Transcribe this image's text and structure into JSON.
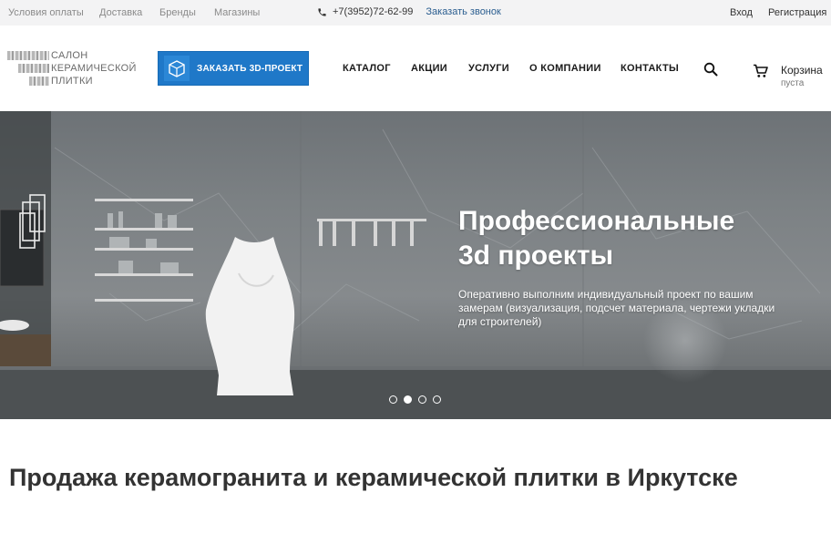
{
  "topbar": {
    "links": [
      "Условия оплаты",
      "Доставка",
      "Бренды",
      "Магазины"
    ],
    "phone": "+7(3952)72-62-99",
    "callback": "Заказать звонок",
    "login": "Вход",
    "register": "Регистрация"
  },
  "logo": {
    "line1": "САЛОН",
    "line2": "КЕРАМИЧЕСКОЙ",
    "line3": "ПЛИТКИ"
  },
  "header": {
    "order_3d_label": "ЗАКАЗАТЬ 3D-ПРОЕКТ",
    "nav": [
      "КАТАЛОГ",
      "АКЦИИ",
      "УСЛУГИ",
      "О КОМПАНИИ",
      "КОНТАКТЫ"
    ],
    "cart_title": "Корзина",
    "cart_status": "пуста"
  },
  "hero": {
    "title_line1": "Профессиональные",
    "title_line2": "3d проекты",
    "text": "Оперативно выполним индивидуальный проект по вашим замерам (визуализация, подсчет материала, чертежи укладки для строителей)",
    "slides_total": 4,
    "active_slide": 2
  },
  "main": {
    "title": "Продажа керамогранита и керамической плитки в Иркутске"
  },
  "colors": {
    "accent": "#1f78c8",
    "callback_link": "#2a5d8f"
  }
}
